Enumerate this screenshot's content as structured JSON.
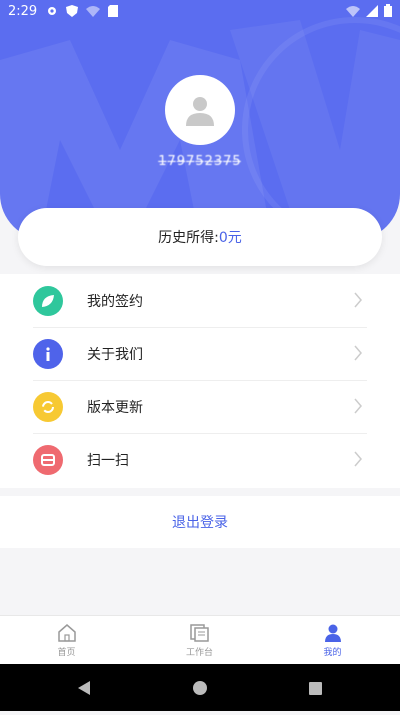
{
  "status_bar": {
    "time": "2:29"
  },
  "profile": {
    "username": "1̶7̶9̶7̶5̶2̶3̶7̶5̶"
  },
  "earnings": {
    "label": "历史所得:",
    "value": "0元"
  },
  "menu": [
    {
      "label": "我的签约",
      "icon": "leaf-icon",
      "color": "#2fc79c"
    },
    {
      "label": "关于我们",
      "icon": "info-icon",
      "color": "#4f63ea"
    },
    {
      "label": "版本更新",
      "icon": "refresh-icon",
      "color": "#f7c933"
    },
    {
      "label": "扫一扫",
      "icon": "scan-icon",
      "color": "#ef6a70"
    }
  ],
  "logout_label": "退出登录",
  "tabs": [
    {
      "label": "首页",
      "icon": "home-icon"
    },
    {
      "label": "工作台",
      "icon": "workbench-icon"
    },
    {
      "label": "我的",
      "icon": "profile-icon"
    }
  ],
  "colors": {
    "brand": "#5b6df0",
    "accent": "#4a63e7"
  }
}
